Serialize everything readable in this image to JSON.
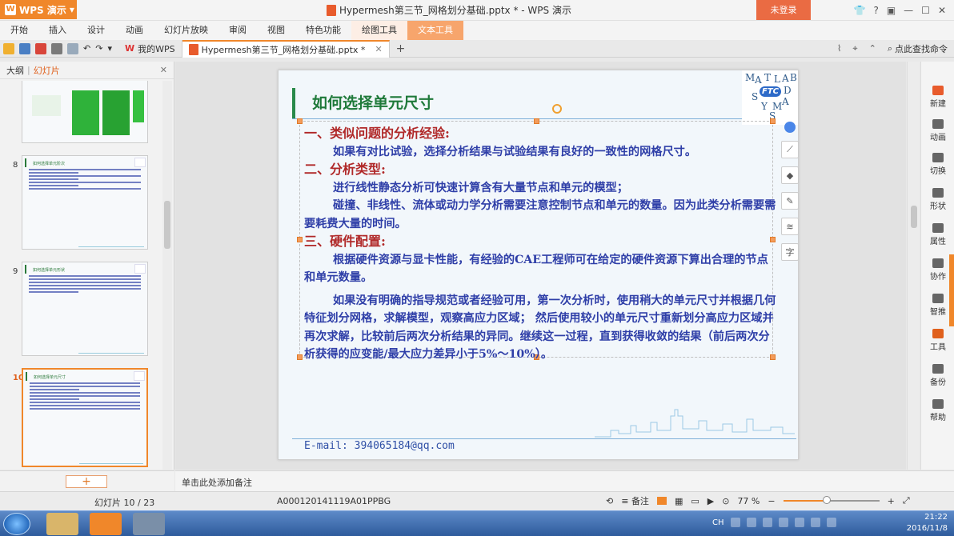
{
  "app": {
    "name": "WPS 演示",
    "title": "Hypermesh第三节_网格划分基础.pptx * - WPS 演示",
    "login_label": "未登录"
  },
  "menu": [
    "开始",
    "插入",
    "设计",
    "动画",
    "幻灯片放映",
    "审阅",
    "视图",
    "特色功能",
    "绘图工具",
    "文本工具"
  ],
  "tabs": [
    {
      "label": "我的WPS"
    },
    {
      "label": "Hypermesh第三节_网格划分基础.pptx *"
    }
  ],
  "search_command": "点此查找命令",
  "left_panel": {
    "tab_outline": "大纲",
    "tab_slides": "幻灯片",
    "thumbs": [
      {
        "num": "8",
        "title": "如何选择单元阶次"
      },
      {
        "num": "9",
        "title": "如何选择单元形状"
      },
      {
        "num": "10",
        "title": "如何选择单元尺寸"
      }
    ]
  },
  "slide": {
    "title": "如何选择单元尺寸",
    "logo_letters": [
      "M",
      "A",
      "T",
      "L",
      "A",
      "B",
      "S",
      "D",
      "Y",
      "A",
      "M",
      "S"
    ],
    "logo_text": "FTC",
    "h1": "一、类似问题的分析经验:",
    "p1": "如果有对比试验，选择分析结果与试验结果有良好的一致性的网格尺寸。",
    "h2": "二、分析类型:",
    "p2a": "进行线性静态分析可快速计算含有大量节点和单元的模型；",
    "p2b": "碰撞、非线性、流体或动力学分析需要注意控制节点和单元的数量。因为此类分析需要需要耗费大量的时间。",
    "h3": "三、硬件配置:",
    "p3": "根据硬件资源与显卡性能，有经验的CAE工程师可在给定的硬件资源下算出合理的节点和单元数量。",
    "p4": "如果没有明确的指导规范或者经验可用，第一次分析时，使用稍大的单元尺寸并根据几何特征划分网格，求解模型，观察高应力区域； 然后使用较小的单元尺寸重新划分高应力区域并再次求解，比较前后两次分析结果的异同。继续这一过程，直到获得收敛的结果（前后两次分析获得的应变能/最大应力差异小于5%～10%）。",
    "email": "E-mail: 394065184@qq.com"
  },
  "right_panel": [
    "新建",
    "动画",
    "切换",
    "形状",
    "属性",
    "协作",
    "智推",
    "工具",
    "备份",
    "帮助"
  ],
  "notes_placeholder": "单击此处添加备注",
  "status": {
    "page": "幻灯片 10 / 23",
    "code": "A000120141119A01PPBG",
    "notes_label": "备注",
    "zoom": "77 %",
    "zoom_fraction": 0.45
  },
  "taskbar": {
    "lang": "CH",
    "time": "21:22",
    "date": "2016/11/8"
  }
}
